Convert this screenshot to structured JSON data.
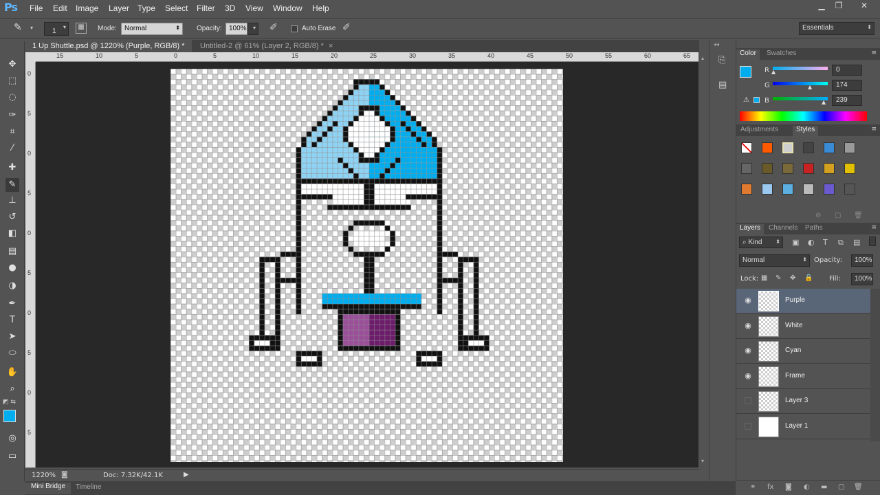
{
  "app": {
    "logo": "Ps"
  },
  "menu": [
    "File",
    "Edit",
    "Image",
    "Layer",
    "Type",
    "Select",
    "Filter",
    "3D",
    "View",
    "Window",
    "Help"
  ],
  "options": {
    "brush_size": "1",
    "mode_label": "Mode:",
    "mode_value": "Normal",
    "opacity_label": "Opacity:",
    "opacity_value": "100%",
    "auto_erase_label": "Auto Erase",
    "workspace": "Essentials"
  },
  "tabs": [
    {
      "label": "1 Up Shuttle.psd @ 1220% (Purple, RGB/8) *",
      "close": "×"
    },
    {
      "label": "Untitled-2 @ 61% (Layer 2, RGB/8) *",
      "close": "×"
    }
  ],
  "ruler_top": [
    "15",
    "10",
    "5",
    "0",
    "5",
    "10",
    "15",
    "20",
    "25",
    "30",
    "35",
    "40",
    "45",
    "50",
    "55",
    "60",
    "65"
  ],
  "ruler_left": [
    "0",
    "5",
    "0",
    "5",
    "0",
    "5",
    "0",
    "5",
    "0",
    "5"
  ],
  "status": {
    "zoom": "1220%",
    "doc": "Doc: 7.32K/42.1K"
  },
  "bottom_tabs": [
    "Mini Bridge",
    "Timeline"
  ],
  "color_panel": {
    "tabs": [
      "Color",
      "Swatches"
    ],
    "r_label": "R",
    "g_label": "G",
    "b_label": "B",
    "r": "0",
    "g": "174",
    "b": "239",
    "fg_color": "#00aeef"
  },
  "styles_panel": {
    "tabs": [
      "Adjustments",
      "Styles"
    ]
  },
  "layers_panel": {
    "tabs": [
      "Layers",
      "Channels",
      "Paths"
    ],
    "filter_kind": "Kind",
    "blend_mode": "Normal",
    "opacity_label": "Opacity:",
    "opacity_value": "100%",
    "lock_label": "Lock:",
    "fill_label": "Fill:",
    "fill_value": "100%",
    "layers": [
      {
        "name": "Purple",
        "visible": true,
        "selected": true
      },
      {
        "name": "White",
        "visible": true,
        "selected": false
      },
      {
        "name": "Cyan",
        "visible": true,
        "selected": false
      },
      {
        "name": "Frame",
        "visible": true,
        "selected": false
      },
      {
        "name": "Layer 3",
        "visible": false,
        "selected": false
      },
      {
        "name": "Layer 1",
        "visible": false,
        "selected": false
      }
    ]
  },
  "colors": {
    "cyan": "#8fd3f4",
    "blue": "#00aeef",
    "purple_light": "#9b4f9a",
    "purple_dark": "#6d1b6b"
  }
}
